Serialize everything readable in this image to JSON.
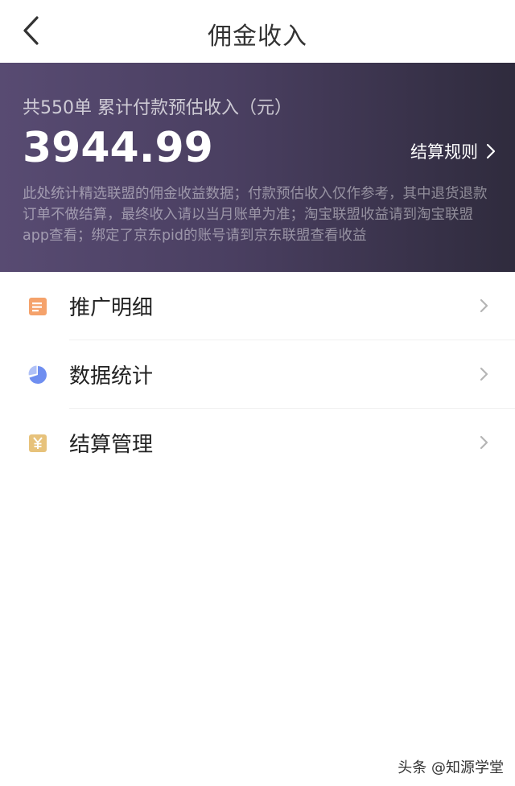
{
  "header": {
    "title": "佣金收入",
    "back_icon": "chevron-left-icon"
  },
  "banner": {
    "summary": "共550单 累计付款预估收入（元）",
    "amount": "3944.99",
    "rules_label": "结算规则",
    "notice": "此处统计精选联盟的佣金收益数据；付款预估收入仅作参考，其中退货退款订单不做结算，最终收入请以当月账单为准；淘宝联盟收益请到淘宝联盟app查看；绑定了京东pid的账号请到京东联盟查看收益",
    "colors": {
      "gradient_start": "#584b72",
      "gradient_end": "#2f2b3d"
    }
  },
  "menu": {
    "items": [
      {
        "label": "推广明细",
        "icon": "document-icon",
        "icon_color": "#f5a26b"
      },
      {
        "label": "数据统计",
        "icon": "pie-chart-icon",
        "icon_color": "#6f8ef0"
      },
      {
        "label": "结算管理",
        "icon": "yuan-icon",
        "icon_color": "#e7c27b"
      }
    ]
  },
  "watermark": "头条 @知源学堂"
}
